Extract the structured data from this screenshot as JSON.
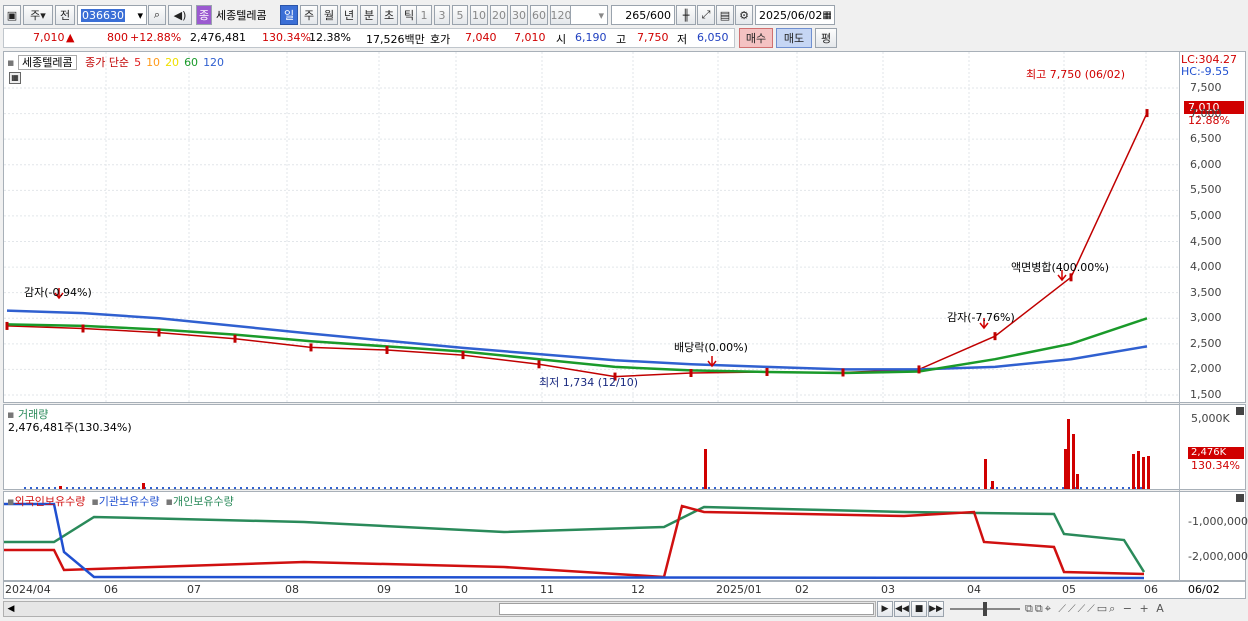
{
  "toolbar": {
    "market": "주",
    "prev": "전",
    "code": "036630",
    "stock_badge": "종",
    "stock_name": "세종텔레콤",
    "periods": [
      "일",
      "주",
      "월",
      "년",
      "분",
      "초",
      "틱"
    ],
    "selected_period": "일",
    "nums": [
      "1",
      "3",
      "5",
      "10",
      "20",
      "30",
      "60",
      "120"
    ],
    "count": "265",
    "count_total": "/600",
    "date": "2025/06/02"
  },
  "quote": {
    "price": "7,010",
    "arrow": "▲",
    "change": "800",
    "change_pct": "+12.88%",
    "volume": "2,476,481",
    "vol_ratio": "130.34%",
    "turnover": "12.38%",
    "amount": "17,526백만",
    "bid_label": "호가",
    "bid1": "7,040",
    "bid2": "7,010",
    "open_label": "시",
    "open": "6,190",
    "high_label": "고",
    "high": "7,750",
    "low_label": "저",
    "low": "6,050",
    "buy": "매수",
    "sell": "매도",
    "eval": "평"
  },
  "price_panel": {
    "name": "세종텔레콤",
    "legend": [
      "종가 단순",
      "5",
      "10",
      "20",
      "60",
      "120"
    ],
    "legend_colors": [
      "#c00000",
      "#e02020",
      "#ff9a1a",
      "#f0e000",
      "#1a9a2a",
      "#3060d0"
    ],
    "lc": "LC:304.27",
    "hc": "HC:-9.55",
    "last_price": "7,010",
    "last_pct": "12.88%",
    "y_ticks": [
      "7,500",
      "7,000",
      "6,500",
      "6,000",
      "5,500",
      "5,000",
      "4,500",
      "4,000",
      "3,500",
      "3,000",
      "2,500",
      "2,000",
      "1,500"
    ],
    "annotations": {
      "reduction1": "감자(-0.94%)",
      "dividend": "배당락(0.00%)",
      "low": "최저 1,734 (12/10)",
      "reduction2": "감자(-7.76%)",
      "split": "액면병합(400.00%)",
      "high": "최고 7,750 (06/02)"
    }
  },
  "volume_panel": {
    "title": "거래량",
    "value": "2,476,481주(130.34%)",
    "y_tick": "5,000K",
    "last": "2,476K",
    "last_pct": "130.34%"
  },
  "holdings_panel": {
    "legend": [
      "외국인보유수량",
      "기관보유수량",
      "개인보유수량"
    ],
    "legend_colors": [
      "#d01010",
      "#2050d0",
      "#2a8a5a"
    ],
    "y_ticks": [
      "-1,000,000",
      "-2,000,000"
    ]
  },
  "x_axis": [
    "2024/04",
    "06",
    "07",
    "08",
    "09",
    "10",
    "11",
    "12",
    "2025/01",
    "02",
    "03",
    "04",
    "05",
    "06"
  ],
  "x_axis_right": "06/02",
  "chart_data": {
    "type": "line",
    "title": "세종텔레콤",
    "series": [
      {
        "name": "종가",
        "values": [
          2850,
          2800,
          2720,
          2600,
          2430,
          2380,
          2280,
          2100,
          1860,
          1930,
          1950,
          1940,
          2000,
          2650,
          3800,
          7010
        ]
      },
      {
        "name": "120",
        "values": [
          3150,
          3100,
          3000,
          2850,
          2700,
          2560,
          2420,
          2300,
          2180,
          2100,
          2050,
          2000,
          2000,
          2050,
          2200,
          2450
        ]
      },
      {
        "name": "60",
        "values": [
          2880,
          2850,
          2780,
          2680,
          2550,
          2450,
          2350,
          2200,
          2050,
          1980,
          1950,
          1930,
          1960,
          2200,
          2500,
          3000
        ]
      }
    ],
    "ylim": [
      1500,
      7750
    ]
  }
}
